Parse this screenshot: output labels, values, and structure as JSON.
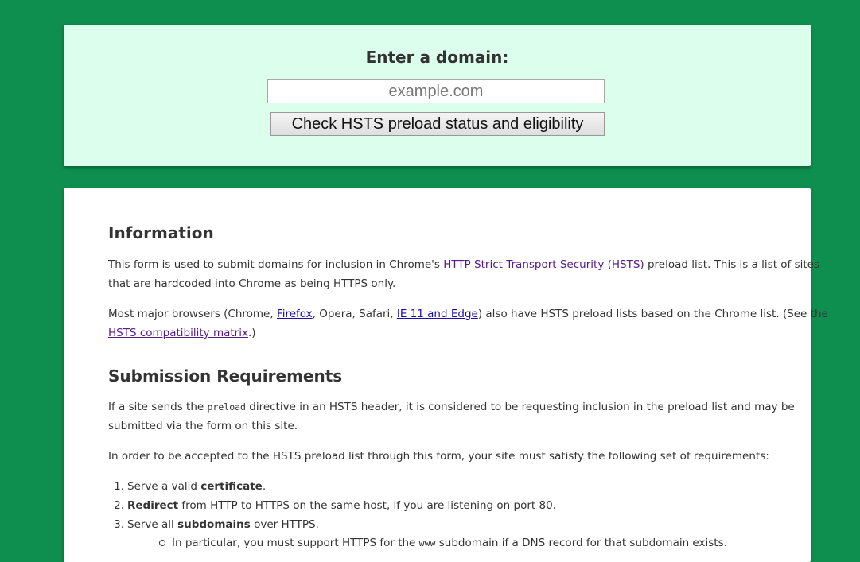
{
  "form": {
    "title": "Enter a domain:",
    "input_placeholder": "example.com",
    "button_label": "Check HSTS preload status and eligibility"
  },
  "information": {
    "heading": "Information",
    "p1_before": "This form is used to submit domains for inclusion in Chrome's ",
    "p1_link": "HTTP Strict Transport Security (HSTS)",
    "p1_after": " preload list. This is a list of sites",
    "p1_line2": "that are hardcoded into Chrome as being HTTPS only.",
    "p2_a": "Most major browsers (Chrome, ",
    "p2_link_firefox": "Firefox",
    "p2_b": ", Opera, Safari, ",
    "p2_link_ie": "IE 11 and Edge",
    "p2_c": ") also have HSTS preload lists based on the Chrome list. (See the",
    "p2_link_matrix": "HSTS compatibility matrix",
    "p2_d": ".)"
  },
  "requirements": {
    "heading": "Submission Requirements",
    "p1_a": "If a site sends the ",
    "p1_code": "preload",
    "p1_b": " directive in an HSTS header, it is considered to be requesting inclusion in the preload list and may be",
    "p1_line2": "submitted via the form on this site.",
    "p2": "In order to be accepted to the HSTS preload list through this form, your site must satisfy the following set of requirements:",
    "items": [
      {
        "num": "1.",
        "pre": "Serve a valid ",
        "bold": "certificate",
        "post": "."
      },
      {
        "num": "2.",
        "pre": "",
        "bold": "Redirect",
        "post": " from HTTP to HTTPS on the same host, if you are listening on port 80."
      },
      {
        "num": "3.",
        "pre": "Serve all ",
        "bold": "subdomains",
        "post": " over HTTPS."
      }
    ],
    "sub_a": "In particular, you must support HTTPS for the ",
    "sub_code": "www",
    "sub_b": " subdomain if a DNS record for that subdomain exists."
  }
}
